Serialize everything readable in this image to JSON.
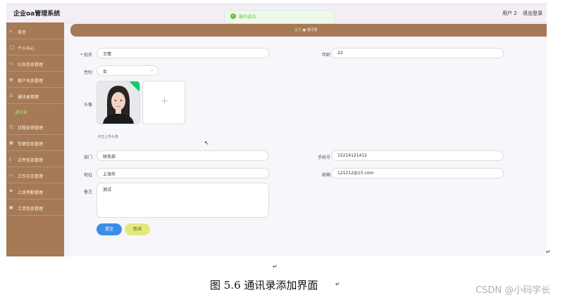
{
  "app": {
    "title": "企业oa管理系统",
    "user_label": "用户 2",
    "logout_label": "退出登录"
  },
  "toast": {
    "icon": "check-circle-icon",
    "message": "操作成功"
  },
  "sidebar": {
    "items": [
      {
        "icon": "home-icon",
        "label": "首页"
      },
      {
        "icon": "user-icon",
        "label": "个人中心"
      },
      {
        "icon": "notice-icon",
        "label": "公告信息管理"
      },
      {
        "icon": "customer-icon",
        "label": "客户关系管理"
      },
      {
        "icon": "contacts-icon",
        "label": "通讯录管理"
      },
      {
        "icon": "calendar-icon",
        "label": "日程安排管理"
      },
      {
        "icon": "archive-icon",
        "label": "车辆信息管理"
      },
      {
        "icon": "file-icon",
        "label": "文件信息管理"
      },
      {
        "icon": "log-icon",
        "label": "工作日志管理"
      },
      {
        "icon": "attendance-icon",
        "label": "上班考勤管理"
      },
      {
        "icon": "salary-icon",
        "label": "工资信息管理"
      }
    ],
    "sub_item": "通讯录"
  },
  "breadcrumb": {
    "home": "首页",
    "separator": "●",
    "current": "通讯录"
  },
  "form": {
    "name_label": "* 姓名",
    "name_value": "王倩",
    "age_label": "年龄",
    "age_value": "22",
    "gender_label": "性别",
    "gender_value": "女",
    "avatar_label": "头像",
    "upload_hint": "点击上传头像",
    "dept_label": "部门",
    "dept_value": "财务部",
    "phone_label": "手机号",
    "phone_value": "15214121412",
    "address_label": "地址",
    "address_value": "上海市",
    "email_label": "邮箱",
    "email_value": "121212@15.com",
    "remark_label": "备注",
    "remark_value": "测试",
    "submit_label": "提交",
    "cancel_label": "取消"
  },
  "document": {
    "caption": "图 5.6 通讯录添加界面",
    "return_mark": "↵",
    "watermark": "CSDN @小码学长"
  }
}
